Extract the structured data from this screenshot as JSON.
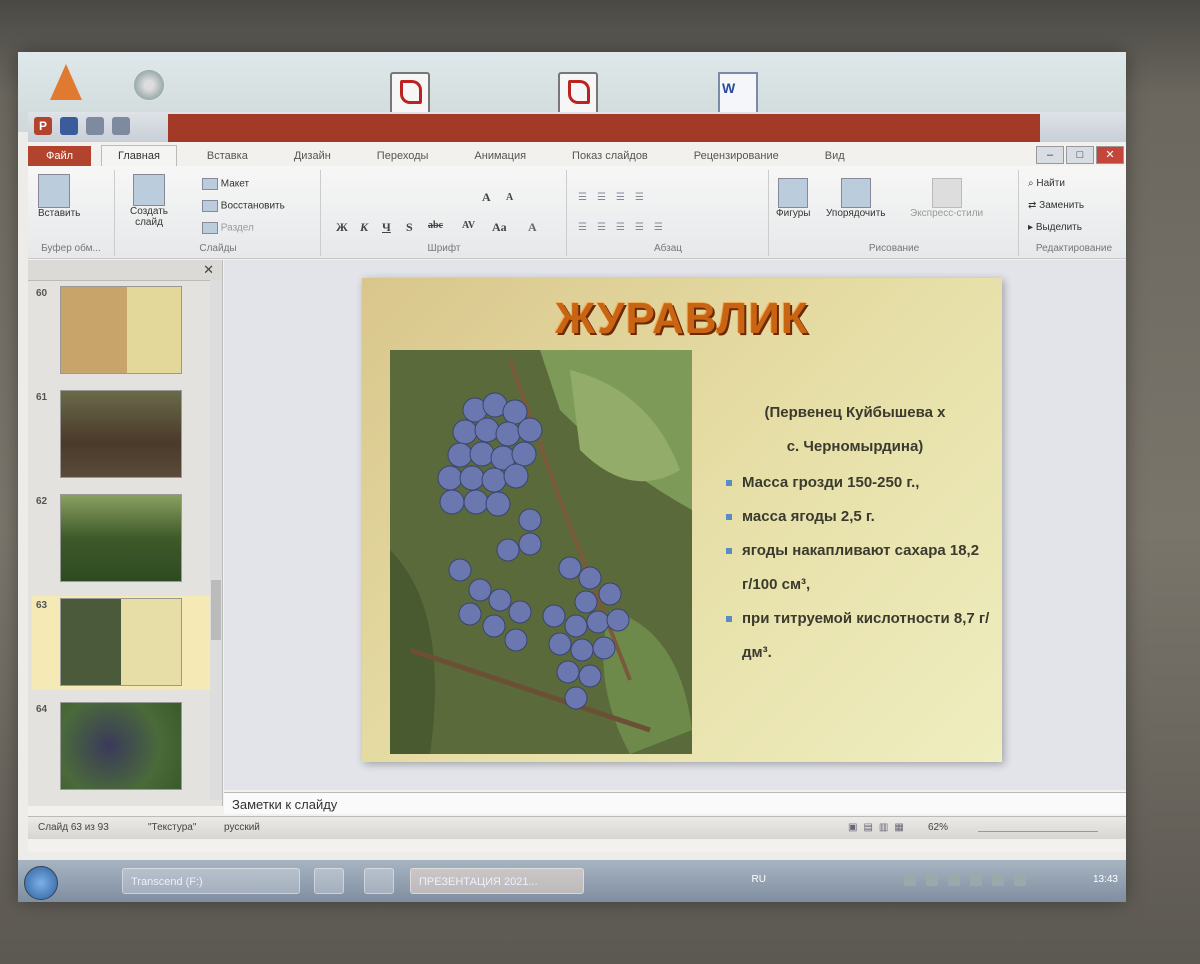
{
  "desktop_icons": [
    "cone-icon",
    "disk-icon",
    "pdf-icon",
    "pdf-icon",
    "word-icon"
  ],
  "ribbon": {
    "file_tab": "Файл",
    "tabs": [
      "Главная",
      "Вставка",
      "Дизайн",
      "Переходы",
      "Анимация",
      "Показ слайдов",
      "Рецензирование",
      "Вид"
    ],
    "clipboard": {
      "paste": "Вставить",
      "group": "Буфер обм..."
    },
    "slides": {
      "create": "Создать",
      "create2": "слайд",
      "layout": "Макет",
      "reset": "Восстановить",
      "section": "Раздел",
      "group": "Слайды"
    },
    "font": {
      "group": "Шрифт"
    },
    "paragraph": {
      "group": "Абзац"
    },
    "drawing": {
      "shapes": "Фигуры",
      "arrange": "Упорядочить",
      "express": "Экспресс-стили",
      "group": "Рисование"
    },
    "editing": {
      "find": "Найти",
      "replace": "Заменить",
      "select": "Выделить",
      "group": "Редактирование"
    }
  },
  "thumbnails": [
    {
      "num": "60"
    },
    {
      "num": "61"
    },
    {
      "num": "62"
    },
    {
      "num": "63"
    },
    {
      "num": "64"
    }
  ],
  "slide": {
    "title": "ЖУРАВЛИК",
    "parent_line1": "(Первенец Куйбышева х",
    "parent_line2": "с. Черномырдина)",
    "bullets": [
      "Масса грозди 150-250 г.,",
      "масса ягоды 2,5 г.",
      "ягоды накапливают сахара 18,2 г/100 см³,",
      "при титруемой кислотности 8,7 г/дм³."
    ]
  },
  "notes_placeholder": "Заметки к слайду",
  "status": {
    "slide": "Слайд 63 из 93",
    "theme": "\"Текстура\"",
    "lang": "русский",
    "zoom": "62%"
  },
  "taskbar": {
    "item1": "Transcend (F:)",
    "item2": "ПРЕЗЕНТАЦИЯ 2021...",
    "lang": "RU",
    "time": "13:43"
  },
  "colors": {
    "accent": "#b2432c",
    "title": "#c96412",
    "bullet": "#5a8bc4"
  }
}
